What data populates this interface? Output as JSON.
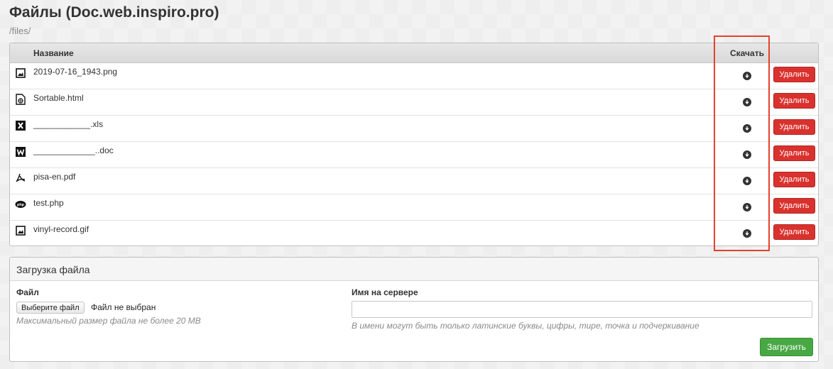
{
  "page": {
    "title": "Файлы (Doc.web.inspiro.pro)",
    "breadcrumb": "/files/"
  },
  "table": {
    "headers": {
      "name": "Название",
      "download": "Скачать"
    },
    "rows": [
      {
        "name": "2019-07-16_1943.png",
        "icon": "image-file-icon",
        "delete_label": "Удалить"
      },
      {
        "name": "Sortable.html",
        "icon": "html-file-icon",
        "delete_label": "Удалить"
      },
      {
        "name": "____________.xls",
        "icon": "excel-file-icon",
        "delete_label": "Удалить"
      },
      {
        "name": "_____________..doc",
        "icon": "word-file-icon",
        "delete_label": "Удалить"
      },
      {
        "name": "pisa-en.pdf",
        "icon": "pdf-file-icon",
        "delete_label": "Удалить"
      },
      {
        "name": "test.php",
        "icon": "php-file-icon",
        "delete_label": "Удалить"
      },
      {
        "name": "vinyl-record.gif",
        "icon": "image-file-icon",
        "delete_label": "Удалить"
      }
    ]
  },
  "upload": {
    "title": "Загрузка файла",
    "file_label": "Файл",
    "choose_button": "Выберите файл",
    "no_file_text": "Файл не выбран",
    "max_size_hint": "Максимальный размер файла не более 20 MB",
    "server_name_label": "Имя на сервере",
    "server_name_value": "",
    "server_name_hint": "В имени могут быть только латинские буквы, цифры, тире, точка и подчеркивание",
    "submit_button": "Загрузить"
  },
  "colors": {
    "delete": "#d9322e",
    "upload": "#48a844",
    "highlight": "#e5412f"
  }
}
